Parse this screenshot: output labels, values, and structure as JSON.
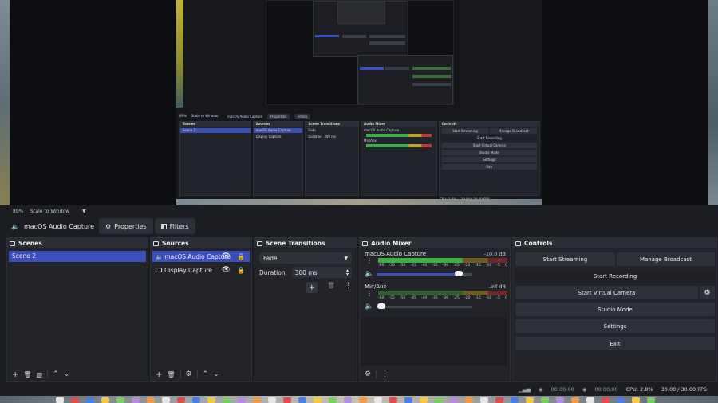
{
  "preview": {
    "zoom": "89%",
    "scale_mode": "Scale to Window"
  },
  "source_toolbar": {
    "source_name": "macOS Audio Capture",
    "properties_label": "Properties",
    "filters_label": "Filters"
  },
  "scenes": {
    "title": "Scenes",
    "items": [
      "Scene 2"
    ]
  },
  "sources": {
    "title": "Sources",
    "items": [
      {
        "name": "macOS Audio Capture",
        "selected": true
      },
      {
        "name": "Display Capture",
        "selected": false
      }
    ]
  },
  "transitions": {
    "title": "Scene Transitions",
    "selected": "Fade",
    "duration_label": "Duration",
    "duration_value": "300 ms"
  },
  "mixer": {
    "title": "Audio Mixer",
    "scale": [
      "-60",
      "-55",
      "-50",
      "-45",
      "-40",
      "-35",
      "-30",
      "-25",
      "-20",
      "-15",
      "-10",
      "-5",
      "0"
    ],
    "tracks": [
      {
        "name": "macOS Audio Capture",
        "db": "-10.0 dB",
        "level": 0.75,
        "volume": 0.86
      },
      {
        "name": "Mic/Aux",
        "db": "-inf dB",
        "level": 0,
        "volume": 0.05
      }
    ]
  },
  "controls": {
    "title": "Controls",
    "start_streaming": "Start Streaming",
    "manage_broadcast": "Manage Broadcast",
    "start_recording": "Start Recording",
    "start_virtual_camera": "Start Virtual Camera",
    "studio_mode": "Studio Mode",
    "settings": "Settings",
    "exit": "Exit"
  },
  "status": {
    "stream_time": "00:00:00",
    "record_time": "00:00:00",
    "cpu": "CPU: 2.8%",
    "fps": "30.00 / 30.00 FPS"
  },
  "mini": {
    "scenes": "Scenes",
    "sources": "Sources",
    "scene_transitions": "Scene Transitions",
    "audio_mixer": "Audio Mixer",
    "controls": "Controls",
    "scene": "Scene 2",
    "source1": "macOS Audio Capture",
    "source2": "Display Capture",
    "fade": "Fade",
    "duration": "Duration",
    "duration_value": "300 ms",
    "mix1": "macOS Audio Capture",
    "mix2": "Mic/Aux",
    "start_streaming": "Start Streaming",
    "manage_broadcast": "Manage Broadcast",
    "start_recording": "Start Recording",
    "start_virtual_camera": "Start Virtual Camera",
    "studio_mode": "Studio Mode",
    "settings": "Settings",
    "exit": "Exit",
    "src_name": "macOS Audio Capture",
    "properties": "Properties",
    "filters": "Filters",
    "zoom": "89%",
    "scale_mode": "Scale to Window",
    "cpu": "CPU: 2.8%",
    "fps": "30.00 / 30.00 FPS"
  },
  "colors": {
    "accent": "#3a4fb8",
    "meter_green": "#3fae46",
    "meter_yellow": "#c3a02a",
    "meter_red": "#b83a3a"
  },
  "icons": {
    "speaker": "speaker-icon",
    "gear": "gear-icon",
    "eye": "eye-icon",
    "lock": "lock-icon"
  }
}
